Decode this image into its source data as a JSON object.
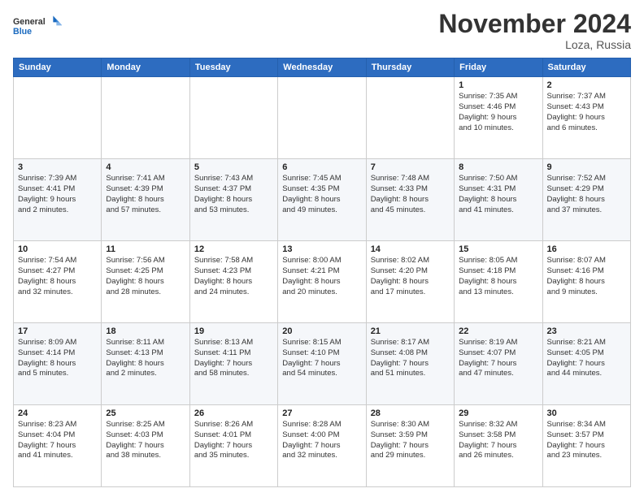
{
  "header": {
    "logo_line1": "General",
    "logo_line2": "Blue",
    "month_title": "November 2024",
    "location": "Loza, Russia"
  },
  "weekdays": [
    "Sunday",
    "Monday",
    "Tuesday",
    "Wednesday",
    "Thursday",
    "Friday",
    "Saturday"
  ],
  "weeks": [
    [
      {
        "day": "",
        "info": ""
      },
      {
        "day": "",
        "info": ""
      },
      {
        "day": "",
        "info": ""
      },
      {
        "day": "",
        "info": ""
      },
      {
        "day": "",
        "info": ""
      },
      {
        "day": "1",
        "info": "Sunrise: 7:35 AM\nSunset: 4:46 PM\nDaylight: 9 hours\nand 10 minutes."
      },
      {
        "day": "2",
        "info": "Sunrise: 7:37 AM\nSunset: 4:43 PM\nDaylight: 9 hours\nand 6 minutes."
      }
    ],
    [
      {
        "day": "3",
        "info": "Sunrise: 7:39 AM\nSunset: 4:41 PM\nDaylight: 9 hours\nand 2 minutes."
      },
      {
        "day": "4",
        "info": "Sunrise: 7:41 AM\nSunset: 4:39 PM\nDaylight: 8 hours\nand 57 minutes."
      },
      {
        "day": "5",
        "info": "Sunrise: 7:43 AM\nSunset: 4:37 PM\nDaylight: 8 hours\nand 53 minutes."
      },
      {
        "day": "6",
        "info": "Sunrise: 7:45 AM\nSunset: 4:35 PM\nDaylight: 8 hours\nand 49 minutes."
      },
      {
        "day": "7",
        "info": "Sunrise: 7:48 AM\nSunset: 4:33 PM\nDaylight: 8 hours\nand 45 minutes."
      },
      {
        "day": "8",
        "info": "Sunrise: 7:50 AM\nSunset: 4:31 PM\nDaylight: 8 hours\nand 41 minutes."
      },
      {
        "day": "9",
        "info": "Sunrise: 7:52 AM\nSunset: 4:29 PM\nDaylight: 8 hours\nand 37 minutes."
      }
    ],
    [
      {
        "day": "10",
        "info": "Sunrise: 7:54 AM\nSunset: 4:27 PM\nDaylight: 8 hours\nand 32 minutes."
      },
      {
        "day": "11",
        "info": "Sunrise: 7:56 AM\nSunset: 4:25 PM\nDaylight: 8 hours\nand 28 minutes."
      },
      {
        "day": "12",
        "info": "Sunrise: 7:58 AM\nSunset: 4:23 PM\nDaylight: 8 hours\nand 24 minutes."
      },
      {
        "day": "13",
        "info": "Sunrise: 8:00 AM\nSunset: 4:21 PM\nDaylight: 8 hours\nand 20 minutes."
      },
      {
        "day": "14",
        "info": "Sunrise: 8:02 AM\nSunset: 4:20 PM\nDaylight: 8 hours\nand 17 minutes."
      },
      {
        "day": "15",
        "info": "Sunrise: 8:05 AM\nSunset: 4:18 PM\nDaylight: 8 hours\nand 13 minutes."
      },
      {
        "day": "16",
        "info": "Sunrise: 8:07 AM\nSunset: 4:16 PM\nDaylight: 8 hours\nand 9 minutes."
      }
    ],
    [
      {
        "day": "17",
        "info": "Sunrise: 8:09 AM\nSunset: 4:14 PM\nDaylight: 8 hours\nand 5 minutes."
      },
      {
        "day": "18",
        "info": "Sunrise: 8:11 AM\nSunset: 4:13 PM\nDaylight: 8 hours\nand 2 minutes."
      },
      {
        "day": "19",
        "info": "Sunrise: 8:13 AM\nSunset: 4:11 PM\nDaylight: 7 hours\nand 58 minutes."
      },
      {
        "day": "20",
        "info": "Sunrise: 8:15 AM\nSunset: 4:10 PM\nDaylight: 7 hours\nand 54 minutes."
      },
      {
        "day": "21",
        "info": "Sunrise: 8:17 AM\nSunset: 4:08 PM\nDaylight: 7 hours\nand 51 minutes."
      },
      {
        "day": "22",
        "info": "Sunrise: 8:19 AM\nSunset: 4:07 PM\nDaylight: 7 hours\nand 47 minutes."
      },
      {
        "day": "23",
        "info": "Sunrise: 8:21 AM\nSunset: 4:05 PM\nDaylight: 7 hours\nand 44 minutes."
      }
    ],
    [
      {
        "day": "24",
        "info": "Sunrise: 8:23 AM\nSunset: 4:04 PM\nDaylight: 7 hours\nand 41 minutes."
      },
      {
        "day": "25",
        "info": "Sunrise: 8:25 AM\nSunset: 4:03 PM\nDaylight: 7 hours\nand 38 minutes."
      },
      {
        "day": "26",
        "info": "Sunrise: 8:26 AM\nSunset: 4:01 PM\nDaylight: 7 hours\nand 35 minutes."
      },
      {
        "day": "27",
        "info": "Sunrise: 8:28 AM\nSunset: 4:00 PM\nDaylight: 7 hours\nand 32 minutes."
      },
      {
        "day": "28",
        "info": "Sunrise: 8:30 AM\nSunset: 3:59 PM\nDaylight: 7 hours\nand 29 minutes."
      },
      {
        "day": "29",
        "info": "Sunrise: 8:32 AM\nSunset: 3:58 PM\nDaylight: 7 hours\nand 26 minutes."
      },
      {
        "day": "30",
        "info": "Sunrise: 8:34 AM\nSunset: 3:57 PM\nDaylight: 7 hours\nand 23 minutes."
      }
    ]
  ]
}
